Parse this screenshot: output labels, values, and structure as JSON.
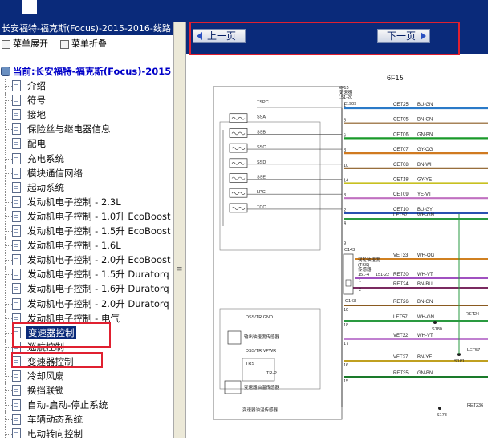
{
  "window": {
    "left_title": "长安福特-福克斯(Focus)-2015-2016-线路"
  },
  "toolbar": {
    "expand_label": "菜单展开",
    "collapse_label": "菜单折叠"
  },
  "tree": {
    "root_label": "当前:长安福特-福克斯(Focus)-2015",
    "items": [
      {
        "label": "介绍"
      },
      {
        "label": "符号"
      },
      {
        "label": "接地"
      },
      {
        "label": "保险丝与继电器信息"
      },
      {
        "label": "配电"
      },
      {
        "label": "充电系统"
      },
      {
        "label": "模块通信网络"
      },
      {
        "label": "起动系统"
      },
      {
        "label": "发动机电子控制 - 2.3L"
      },
      {
        "label": "发动机电子控制 - 1.0升 EcoBoost"
      },
      {
        "label": "发动机电子控制 - 1.5升 EcoBoost"
      },
      {
        "label": "发动机电子控制 - 1.6L"
      },
      {
        "label": "发动机电子控制 - 2.0升 EcoBoost"
      },
      {
        "label": "发动机电子控制 - 1.5升 Duratorq"
      },
      {
        "label": "发动机电子控制 - 1.6升 Duratorq"
      },
      {
        "label": "发动机电子控制 - 2.0升 Duratorq"
      },
      {
        "label": "发动机电子控制 - 电气"
      },
      {
        "label": "变速器控制",
        "selected": true
      },
      {
        "label": "巡航控制"
      },
      {
        "label": "变速器控制"
      },
      {
        "label": "冷却风扇"
      },
      {
        "label": "换挡联锁"
      },
      {
        "label": "自动-启动-停止系统"
      },
      {
        "label": "车辆动态系统"
      },
      {
        "label": "电动转向控制"
      }
    ]
  },
  "nav": {
    "prev_label": "上一页",
    "next_label": "下一页"
  },
  "diagram": {
    "sheet_code": "6F15",
    "module_label_1": "6F15",
    "module_label_2": "变速器",
    "module_label_3": "151-20",
    "connector_top": "C1909",
    "signals": [
      {
        "name": "TSPC",
        "pin": "1",
        "wire": "CET25",
        "color_code": "BU-GN",
        "color": "#2a7ac8"
      },
      {
        "name": "SSA",
        "pin": "5",
        "wire": "CET05",
        "color_code": "BN-GN",
        "color": "#8a5a20"
      },
      {
        "name": "SSB",
        "pin": "6",
        "wire": "CET06",
        "color_code": "GN-BN",
        "color": "#1a9a2a"
      },
      {
        "name": "SSC",
        "pin": "8",
        "wire": "CET07",
        "color_code": "GY-OG",
        "color": "#d07a20"
      },
      {
        "name": "SSD",
        "pin": "10",
        "wire": "CET08",
        "color_code": "BN-WH",
        "color": "#8a5a20"
      },
      {
        "name": "SSE",
        "pin": "14",
        "wire": "CET18",
        "color_code": "GY-YE",
        "color": "#c8c020"
      },
      {
        "name": "LPC",
        "pin": "3",
        "wire": "CET09",
        "color_code": "YE-VT",
        "color": "#c070c0"
      },
      {
        "name": "TCC",
        "pin": "2",
        "wire": "CET10",
        "color_code": "BU-GY",
        "color": "#2a50b0"
      }
    ],
    "lower_wires": [
      {
        "pin": "4",
        "wire": "LET57",
        "color_code": "WH-GN",
        "color": "#2a9a40"
      },
      {
        "pin": "",
        "wire": "VET33",
        "color_code": "WH-OG",
        "color": "#d08020"
      },
      {
        "pin": "",
        "wire": "RET30",
        "color_code": "WH-VT",
        "color": "#a050c0"
      },
      {
        "pin": "20",
        "wire": "RET24",
        "color_code": "BN-BU",
        "color": "#7a2a60"
      },
      {
        "pin": "19",
        "wire": "RET26",
        "color_code": "BN-GN",
        "color": "#8a5a20"
      },
      {
        "pin": "18",
        "wire": "LET57",
        "color_code": "WH-GN",
        "color": "#2a9a40"
      },
      {
        "pin": "17",
        "wire": "VET32",
        "color_code": "WH-VT",
        "color": "#c080d0"
      },
      {
        "pin": "16",
        "wire": "VET27",
        "color_code": "BN-YE",
        "color": "#c0a020"
      },
      {
        "pin": "15",
        "wire": "RET35",
        "color_code": "GN-BN",
        "color": "#1a7a2a"
      }
    ],
    "c143_label": "C143",
    "c143b_label": "C143",
    "tss_label_1": "涡轮轴速度",
    "tss_label_2": "(TSS)",
    "tss_label_3": "传感器",
    "tss_label_4": "151-4",
    "tss_label_5": "151-22",
    "dss_gnd": "DSS/TR GND",
    "dss_vpwr": "DSS/TR VPWR",
    "trs_label": "TRS",
    "trp_label": "TR-P",
    "sensor_label_1": "输出轴速度传感器",
    "sensor_label_2": "变速器油温传感器",
    "bottom_label": "变速器油温传感器",
    "splice_s180": "S180",
    "splice_s181": "S181",
    "splice_s178": "S178",
    "ret24_right": "RET24",
    "let57_right": "LET57",
    "ret236": "RET236",
    "pin_9": "9",
    "pin_c143_1": "1",
    "pin_c143_2": "2"
  }
}
